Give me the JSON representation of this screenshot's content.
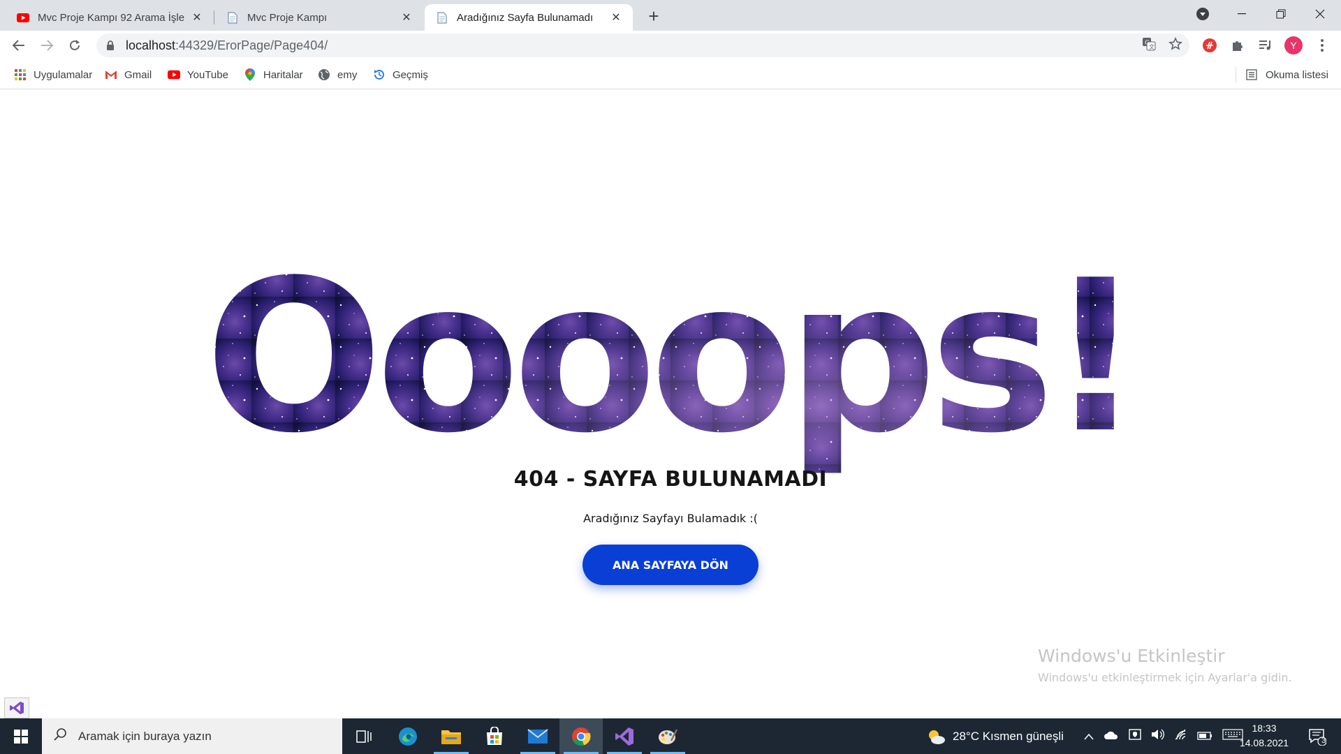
{
  "browser": {
    "tabs": [
      {
        "title": "Mvc Proje Kampı 92 Arama İşlemi",
        "favicon": "youtube-icon"
      },
      {
        "title": "Mvc Proje Kampı",
        "favicon": "page-icon"
      },
      {
        "title": "Aradığınız Sayfa Bulunamadı",
        "favicon": "page-icon"
      }
    ],
    "active_tab": 2,
    "url_host": "localhost",
    "url_path": ":44329/ErorPage/Page404/",
    "profile_initial": "Y",
    "bookmarks": [
      {
        "label": "Uygulamalar",
        "icon": "apps-grid-icon"
      },
      {
        "label": "Gmail",
        "icon": "gmail-icon"
      },
      {
        "label": "YouTube",
        "icon": "youtube-icon"
      },
      {
        "label": "Haritalar",
        "icon": "maps-pin-icon"
      },
      {
        "label": "emy",
        "icon": "globe-icon"
      },
      {
        "label": "Geçmiş",
        "icon": "history-icon"
      }
    ],
    "reading_list": "Okuma listesi"
  },
  "page": {
    "hero_text": "Oooops!",
    "error_title": "404 - SAYFA BULUNAMADI",
    "error_subtitle": "Aradığınız Sayfayı Bulamadık :(",
    "home_button": "ANA SAYFAYA DÖN",
    "watermark_title": "Windows'u Etkinleştir",
    "watermark_sub": "Windows'u etkinleştirmek için Ayarlar'a gidin.",
    "colors": {
      "button": "#0a3fd6",
      "text": "#151515",
      "galaxy_dark": "#12103a",
      "galaxy_mid": "#3a2a8a"
    }
  },
  "taskbar": {
    "search_placeholder": "Aramak için buraya yazın",
    "weather": "28°C  Kısmen güneşli",
    "time": "18:33",
    "date": "14.08.2021",
    "notification_count": "3"
  }
}
